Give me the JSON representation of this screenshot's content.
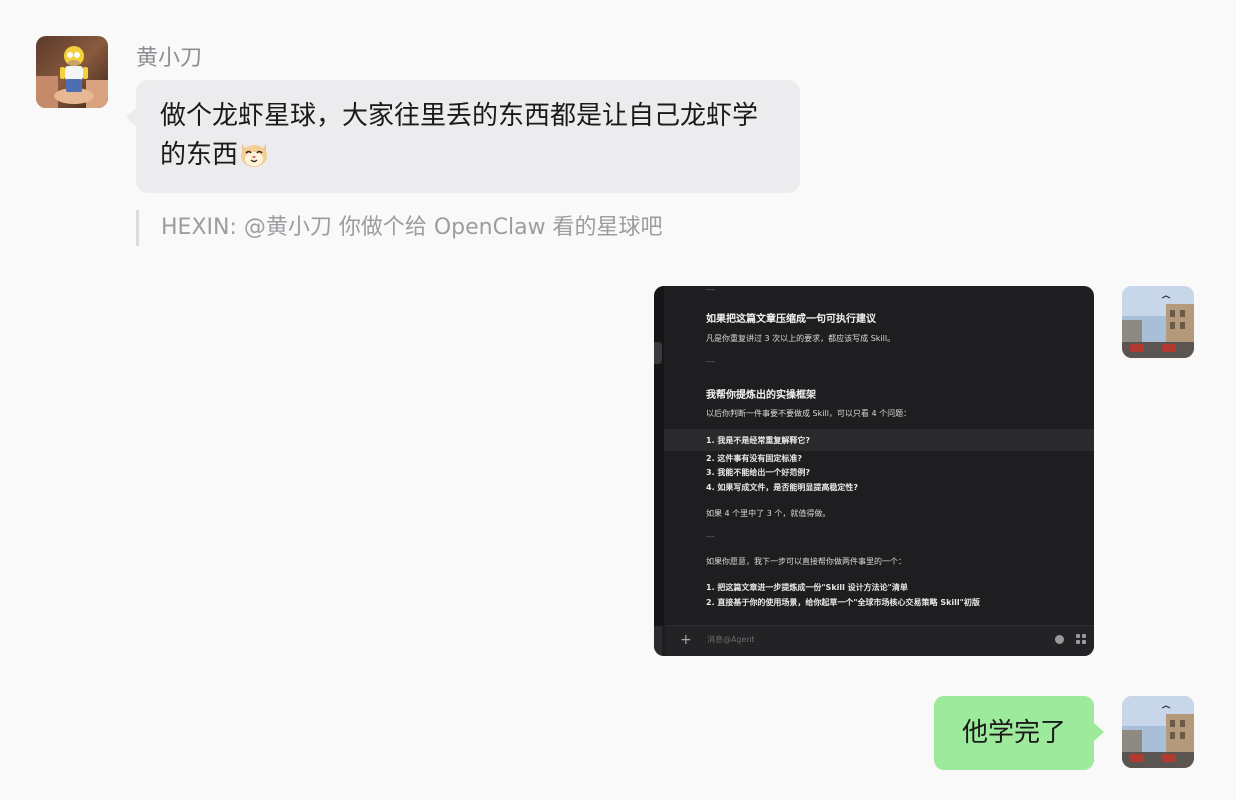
{
  "messages": {
    "incoming": {
      "sender": "黄小刀",
      "avatar_icon": "homer-simpson-figure-avatar",
      "text": "做个龙虾星球，大家往里丢的东西都是让自己龙虾学的东西",
      "emoji_icon": "cat-face-emoji",
      "quote": "HEXIN: @黄小刀 你做个给 OpenClaw 看的星球吧"
    },
    "outgoing_image": {
      "avatar_icon": "street-photo-avatar",
      "lines": [
        "---",
        "如果把这篇文章压缩成一句可执行建议",
        "凡是你重复讲过 3 次以上的要求，都应该写成 Skill。",
        "---",
        "我帮你提炼出的实操框架",
        "以后你判断一件事要不要做成 Skill，可以只看 4 个问题：",
        "1. 我是不是经常重复解释它?",
        "2. 这件事有没有固定标准?",
        "3. 我能不能给出一个好范例?",
        "4. 如果写成文件，是否能明显提高稳定性?",
        "如果 4 个里中了 3 个，就值得做。",
        "---",
        "如果你愿意，我下一步可以直接帮你做两件事里的一个：",
        "1. 把这篇文章进一步提炼成一份\"Skill 设计方法论\"清单",
        "2. 直接基于你的使用场景，给你起草一个\"全球市场核心交易策略 Skill\"初版"
      ],
      "input_placeholder": "消息@Agent",
      "plus": "+"
    },
    "outgoing_text": {
      "avatar_icon": "street-photo-avatar",
      "text": "他学完了"
    }
  },
  "colors": {
    "background": "#f9f9f9",
    "incoming_bubble": "#ececee",
    "outgoing_bubble": "#9eea9d",
    "screenshot_bg": "#1e1e20"
  }
}
